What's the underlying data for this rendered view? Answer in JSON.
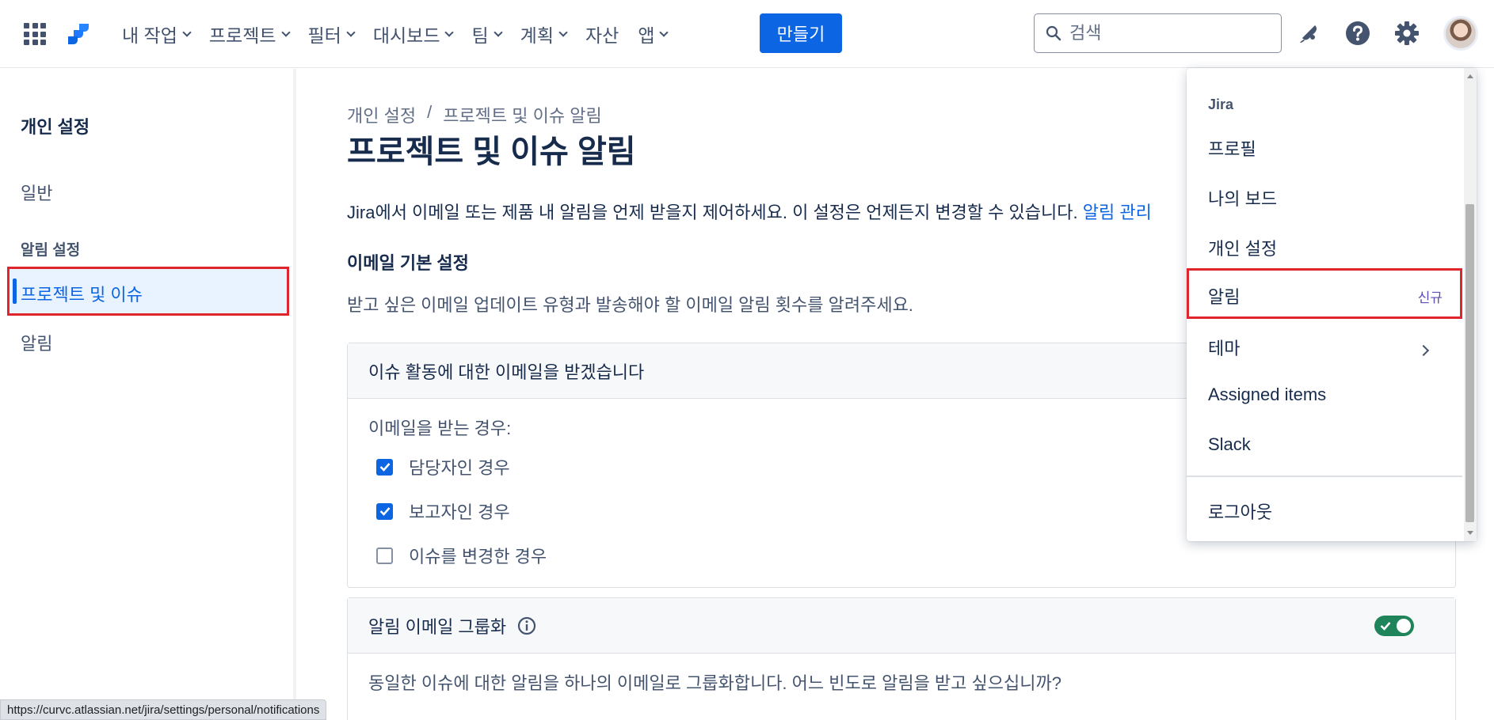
{
  "topbar": {
    "nav": [
      {
        "label": "내 작업",
        "dropdown": true
      },
      {
        "label": "프로젝트",
        "dropdown": true
      },
      {
        "label": "필터",
        "dropdown": true
      },
      {
        "label": "대시보드",
        "dropdown": true
      },
      {
        "label": "팀",
        "dropdown": true
      },
      {
        "label": "계획",
        "dropdown": true
      },
      {
        "label": "자산",
        "dropdown": false
      },
      {
        "label": "앱",
        "dropdown": true
      }
    ],
    "create_label": "만들기",
    "search_placeholder": "검색",
    "icons": [
      "apps-grid-icon",
      "jira-logo",
      "search-icon",
      "notifications-icon",
      "help-icon",
      "settings-icon",
      "avatar"
    ]
  },
  "sidebar": {
    "title": "개인 설정",
    "general": "일반",
    "section": "알림 설정",
    "active_item": "프로젝트 및 이슈",
    "notifications": "알림"
  },
  "main": {
    "breadcrumb": [
      "개인 설정",
      "프로젝트 및 이슈 알림"
    ],
    "breadcrumb_sep": "/",
    "title": "프로젝트 및 이슈 알림",
    "intro": "Jira에서 이메일 또는 제품 내 알림을 언제 받을지 제어하세요. 이 설정은 언제든지 변경할 수 있습니다.",
    "intro_link": "알림 관리",
    "email_heading": "이메일 기본 설정",
    "email_sub": "받고 싶은 이메일 업데이트 유형과 발송해야 할 이메일 알림 횟수를 알려주세요.",
    "activity_panel": {
      "title": "이슈 활동에 대한 이메일을 받겠습니다",
      "when": "이메일을 받는 경우:",
      "options": [
        {
          "label": "담당자인 경우",
          "checked": true
        },
        {
          "label": "보고자인 경우",
          "checked": true
        },
        {
          "label": "이슈를 변경한 경우",
          "checked": false
        }
      ]
    },
    "grouping_panel": {
      "title": "알림 이메일 그룹화",
      "toggle_on": true,
      "description": "동일한 이슈에 대한 알림을 하나의 이메일로 그룹화합니다. 어느 빈도로 알림을 받고 싶으십니까?"
    }
  },
  "profile_menu": {
    "section": "Jira",
    "items": [
      "프로필",
      "나의 보드",
      "개인 설정"
    ],
    "highlighted": {
      "label": "알림",
      "badge": "신규"
    },
    "theme": "테마",
    "assigned": "Assigned items",
    "slack": "Slack",
    "logout": "로그아웃"
  },
  "status_url": "https://curvc.atlassian.net/jira/settings/personal/notifications",
  "colors": {
    "brand": "#0c66e4",
    "highlight": "#e0242d",
    "toggle_on": "#1f845a",
    "badge": "#5e4db2"
  }
}
